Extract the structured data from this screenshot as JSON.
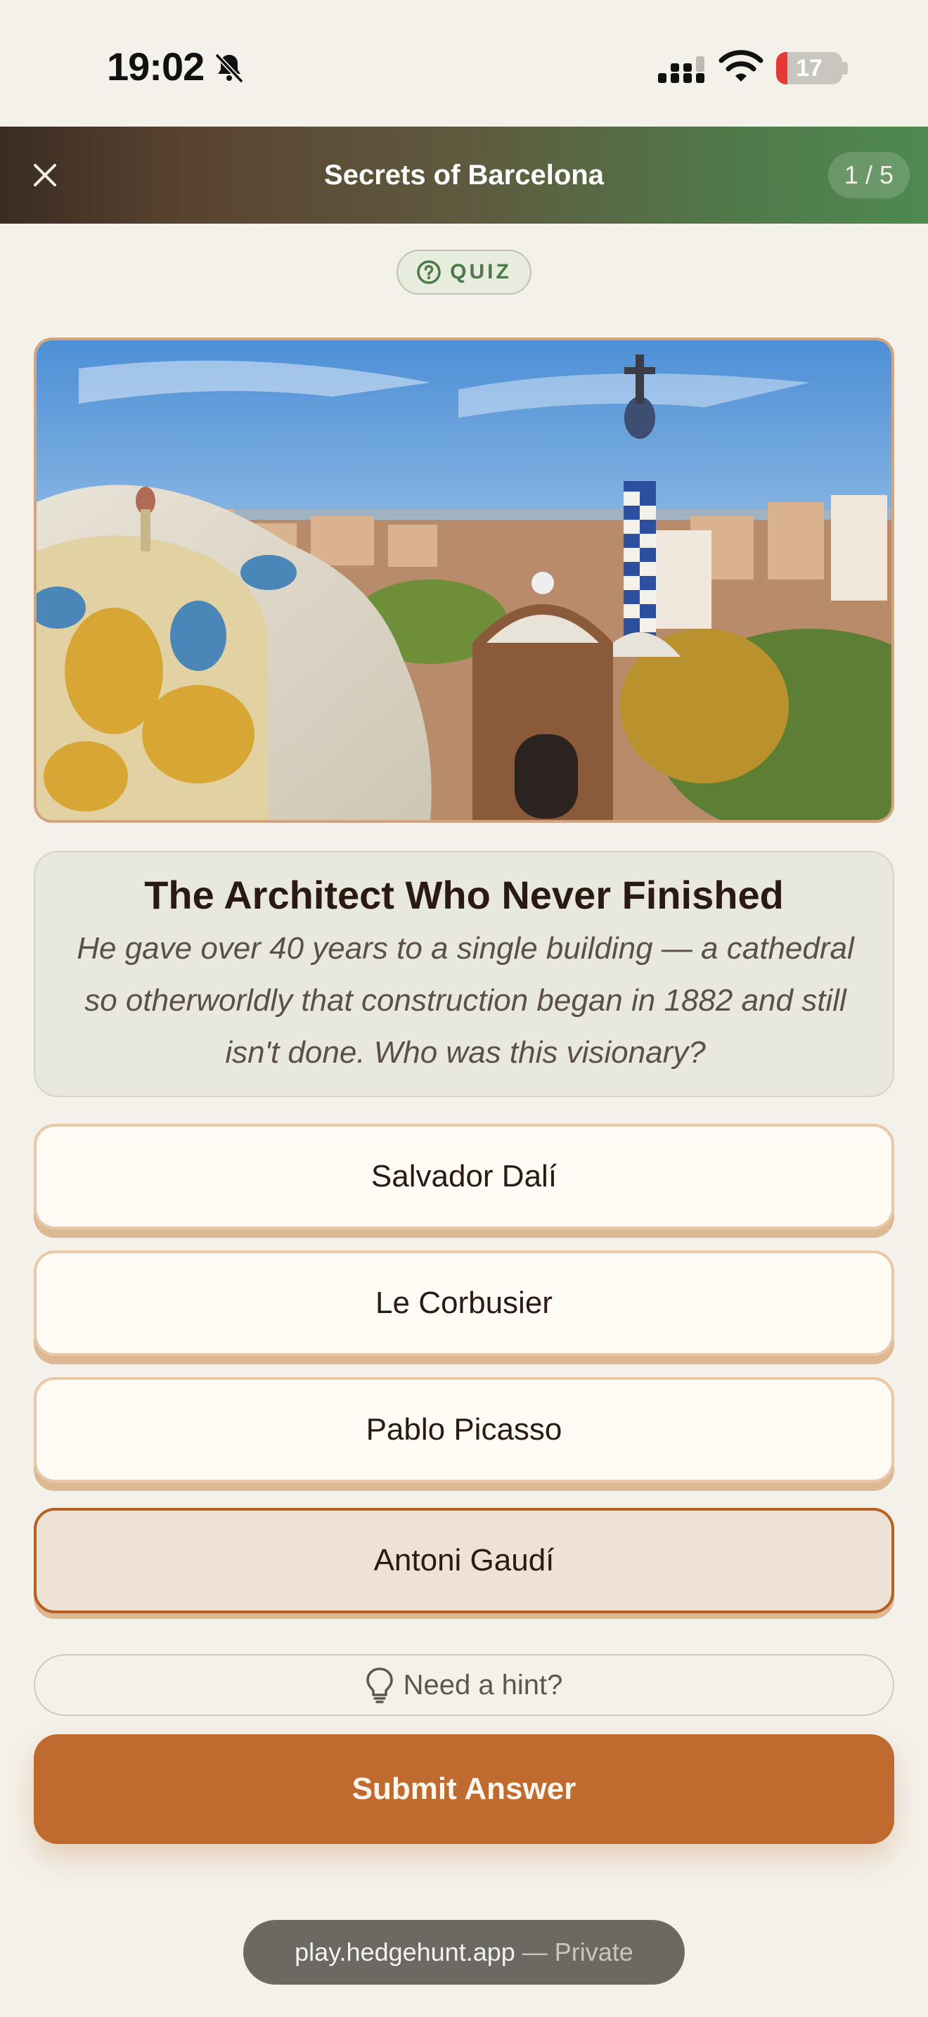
{
  "status_bar": {
    "time": "19:02",
    "battery_level": "17",
    "battery_fraction": 0.17,
    "icons": [
      "bell-slash-icon",
      "cellular-signal-icon",
      "wifi-icon",
      "battery-icon"
    ]
  },
  "header": {
    "title": "Secrets of Barcelona",
    "progress": "1 / 5",
    "close_icon": "close-icon"
  },
  "badge": {
    "label": "QUIZ",
    "icon": "question-circle-icon"
  },
  "image": {
    "icon": "park-guell-photo"
  },
  "question": {
    "title": "The Architect Who Never Finished",
    "text": "He gave over 40 years to a single building — a cathedral so otherworldly that construction began in 1882 and still isn't done. Who was this visionary?"
  },
  "options": [
    {
      "label": "Salvador Dalí",
      "selected": false
    },
    {
      "label": "Le Corbusier",
      "selected": false
    },
    {
      "label": "Pablo Picasso",
      "selected": false
    },
    {
      "label": "Antoni Gaudí",
      "selected": true
    }
  ],
  "hint": {
    "label": "Need a hint?",
    "icon": "lightbulb-icon"
  },
  "submit": {
    "label": "Submit Answer"
  },
  "browser": {
    "host": "play.hedgehunt.app",
    "separator": "—",
    "mode": "Private"
  },
  "colors": {
    "background": "#f4f1ea",
    "accent": "#bf6a2e",
    "badge_green": "#4b7a46",
    "selected_border": "#b85f22"
  }
}
